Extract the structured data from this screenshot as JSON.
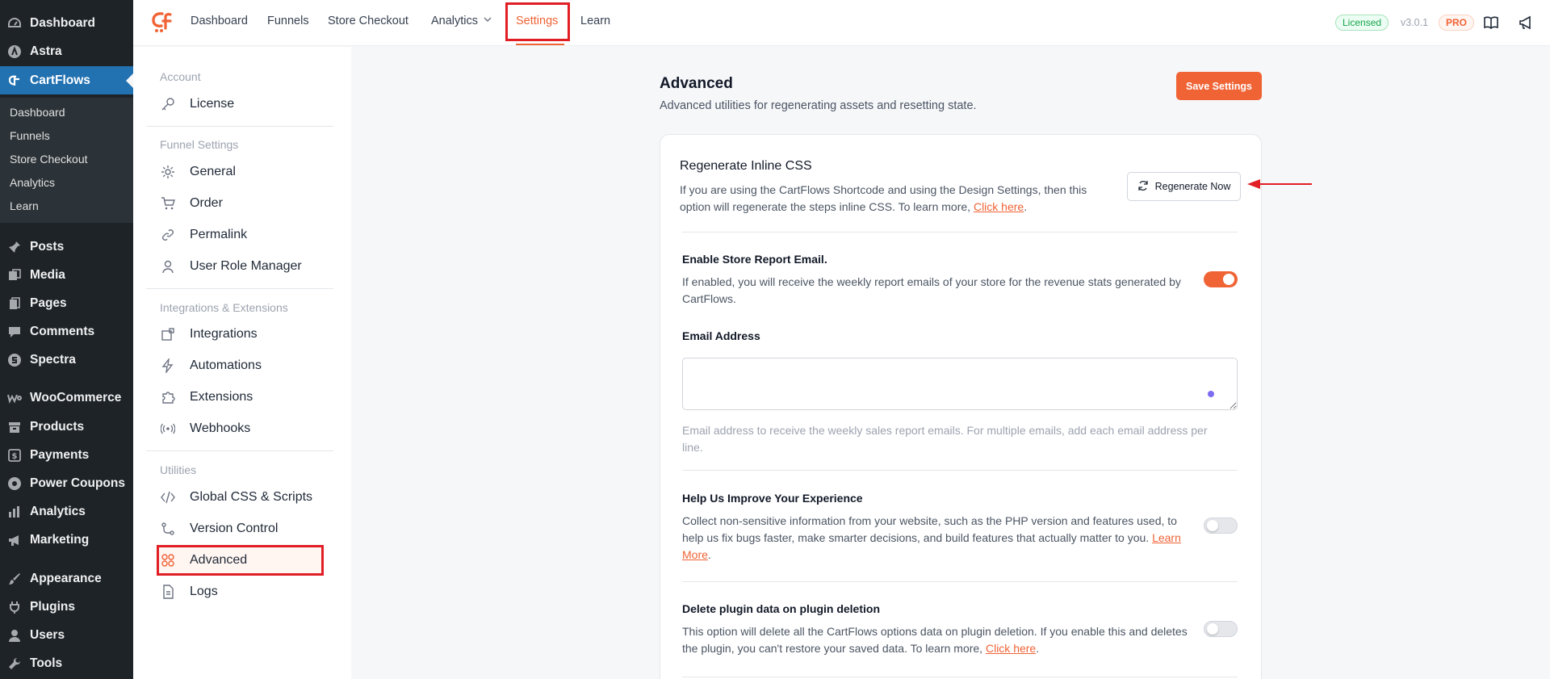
{
  "wp_menu": {
    "items": [
      {
        "label": "Dashboard",
        "icon": "dashboard-icon"
      },
      {
        "label": "Astra",
        "icon": "astra-icon"
      },
      {
        "label": "CartFlows",
        "icon": "cartflows-icon"
      },
      {
        "label": "Posts",
        "icon": "pin-icon"
      },
      {
        "label": "Media",
        "icon": "media-icon"
      },
      {
        "label": "Pages",
        "icon": "pages-icon"
      },
      {
        "label": "Comments",
        "icon": "comment-icon"
      },
      {
        "label": "Spectra",
        "icon": "spectra-icon"
      },
      {
        "label": "WooCommerce",
        "icon": "woo-icon"
      },
      {
        "label": "Products",
        "icon": "archive-icon"
      },
      {
        "label": "Payments",
        "icon": "dollar-icon"
      },
      {
        "label": "Power Coupons",
        "icon": "coupon-icon"
      },
      {
        "label": "Analytics",
        "icon": "bar-chart-icon"
      },
      {
        "label": "Marketing",
        "icon": "megaphone-icon"
      },
      {
        "label": "Appearance",
        "icon": "brush-icon"
      },
      {
        "label": "Plugins",
        "icon": "plug-icon"
      },
      {
        "label": "Users",
        "icon": "user-icon"
      },
      {
        "label": "Tools",
        "icon": "wrench-icon"
      }
    ],
    "submenu": [
      "Dashboard",
      "Funnels",
      "Store Checkout",
      "Analytics",
      "Learn"
    ]
  },
  "topnav": {
    "items": [
      "Dashboard",
      "Funnels",
      "Store Checkout",
      "Analytics",
      "Settings",
      "Learn"
    ],
    "licensed": "Licensed",
    "version": "v3.0.1",
    "pro": "PRO"
  },
  "settings_nav": {
    "groups": [
      {
        "title": "Account",
        "items": [
          "License"
        ]
      },
      {
        "title": "Funnel Settings",
        "items": [
          "General",
          "Order",
          "Permalink",
          "User Role Manager"
        ]
      },
      {
        "title": "Integrations & Extensions",
        "items": [
          "Integrations",
          "Automations",
          "Extensions",
          "Webhooks"
        ]
      },
      {
        "title": "Utilities",
        "items": [
          "Global CSS & Scripts",
          "Version Control",
          "Advanced",
          "Logs"
        ]
      }
    ]
  },
  "main": {
    "title": "Advanced",
    "subtitle": "Advanced utilities for regenerating assets and resetting state.",
    "save_label": "Save Settings",
    "regen": {
      "title": "Regenerate Inline CSS",
      "text": "If you are using the CartFlows Shortcode and using the Design Settings, then this option will regenerate the steps inline CSS. To learn more,",
      "link": "Click here",
      "button": "Regenerate Now"
    },
    "report": {
      "title": "Enable Store Report Email.",
      "text": "If enabled, you will receive the weekly report emails of your store for the revenue stats generated by CartFlows.",
      "enabled": true
    },
    "email": {
      "label": "Email Address",
      "value": "",
      "help": "Email address to receive the weekly sales report emails. For multiple emails, add each email address per line."
    },
    "improve": {
      "title": "Help Us Improve Your Experience",
      "text": "Collect non-sensitive information from your website, such as the PHP version and features used, to help us fix bugs faster, make smarter decisions, and build features that actually matter to you.",
      "link": "Learn More",
      "enabled": false
    },
    "delete": {
      "title": "Delete plugin data on plugin deletion",
      "text": "This option will delete all the CartFlows options data on plugin deletion. If you enable this and deletes the plugin, you can't restore your saved data. To learn more,",
      "link": "Click here",
      "enabled": false
    }
  },
  "colors": {
    "accent": "#f06335",
    "wp_active": "#2271b1",
    "highlight": "#e01e24"
  }
}
